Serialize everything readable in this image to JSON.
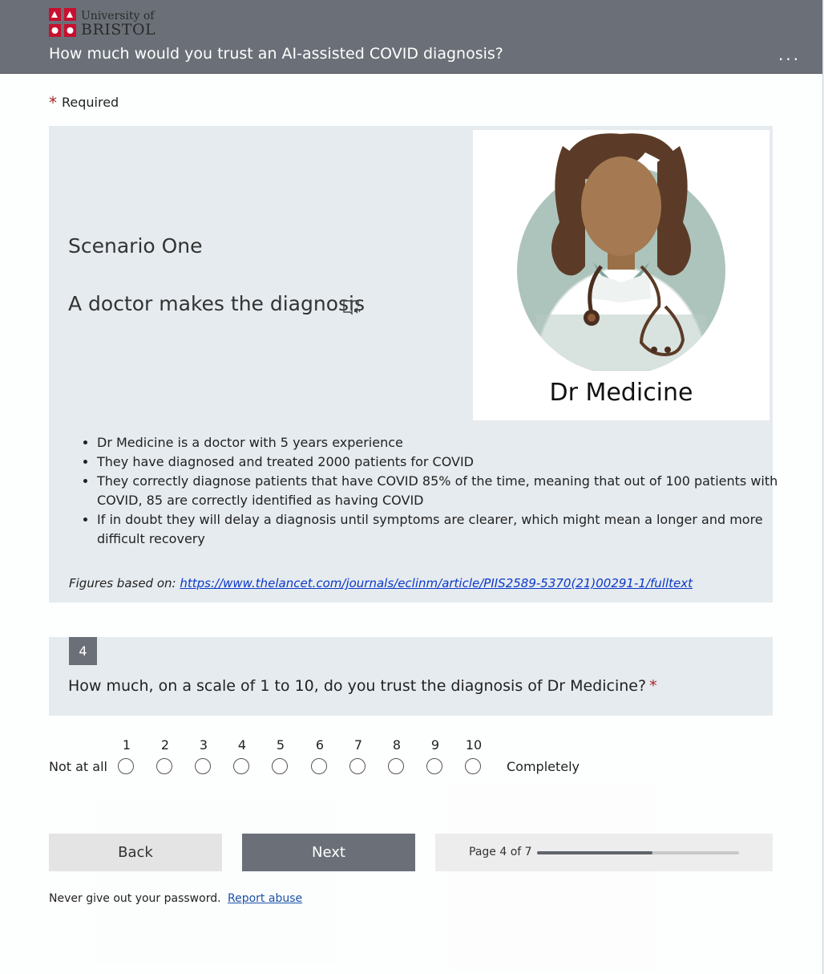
{
  "header": {
    "logo_line1": "University of",
    "logo_line2": "BRISTOL",
    "title": "How much would you trust an AI-assisted COVID diagnosis?",
    "more_label": "..."
  },
  "required_label": "Required",
  "scenario": {
    "title": "Scenario One",
    "subtitle": "A doctor makes the diagnosis",
    "doctor_name": "Dr Medicine",
    "bullets": [
      "Dr Medicine is a doctor with 5 years experience",
      "They have diagnosed and treated 2000 patients for COVID",
      "They correctly diagnose patients that have COVID  85% of the time, meaning that out of 100 patients with COVID, 85 are correctly identified as having COVID",
      "If in doubt they will delay a diagnosis until symptoms are clearer, which might mean a longer and more difficult recovery"
    ],
    "figures_prefix": "Figures based on:",
    "figures_link": "https://www.thelancet.com/journals/eclinm/article/PIIS2589-5370(21)00291-1/fulltext"
  },
  "question": {
    "number": "4",
    "text": "How much, on a scale of 1 to 10, do you trust the diagnosis of Dr Medicine?",
    "required_mark": "*",
    "scale_low": "Not at all",
    "scale_high": "Completely",
    "options": [
      "1",
      "2",
      "3",
      "4",
      "5",
      "6",
      "7",
      "8",
      "9",
      "10"
    ]
  },
  "nav": {
    "back_label": "Back",
    "next_label": "Next",
    "page_label": "Page 4 of 7",
    "progress_fraction": 0.57
  },
  "footer": {
    "text": "Never give out your password.",
    "link": "Report abuse"
  },
  "colors": {
    "header": "#6b7078",
    "accent_red": "#a4262c",
    "panel": "#e4e9ee"
  }
}
